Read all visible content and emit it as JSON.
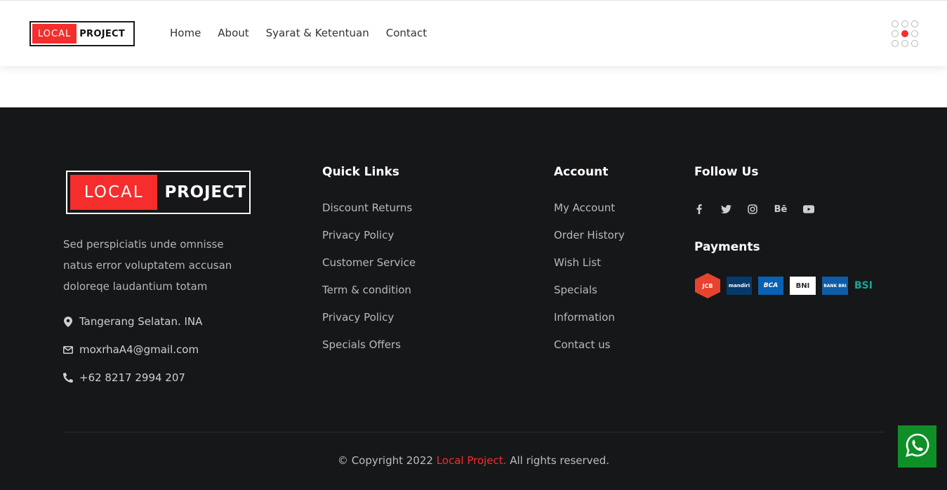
{
  "header": {
    "logo": {
      "left": "LOCAL",
      "right": "PROJECT"
    },
    "nav": [
      "Home",
      "About",
      "Syarat & Ketentuan",
      "Contact"
    ],
    "menu_icon": "dots-grid-icon"
  },
  "footer": {
    "logo": {
      "left": "LOCAL",
      "right": "PROJECT"
    },
    "about": "Sed perspiciatis unde omnisse natus error voluptatem accusan doloreqe laudantium totam",
    "contacts": {
      "address": "Tangerang Selatan. INA",
      "email": "moxrhaA4@gmail.com",
      "phone": "+62 8217 2994 207"
    },
    "quick_links": {
      "title": "Quick Links",
      "items": [
        "Discount Returns",
        "Privacy Policy",
        "Customer Service",
        "Term & condition",
        "Privacy Policy",
        "Specials Offers"
      ]
    },
    "account": {
      "title": "Account",
      "items": [
        "My Account",
        "Order History",
        "Wish List",
        "Specials",
        "Information",
        "Contact us"
      ]
    },
    "follow": {
      "title": "Follow Us",
      "icons": [
        "facebook-icon",
        "twitter-icon",
        "instagram-icon",
        "behance-icon",
        "youtube-icon"
      ]
    },
    "payments": {
      "title": "Payments",
      "logos": [
        "JCB",
        "mandiri",
        "BCA",
        "BNI",
        "BANK BRI",
        "BSI"
      ]
    },
    "copyright": {
      "prefix": "© Copyright 2022 ",
      "brand": "Local Project.",
      "suffix": " All rights reserved."
    }
  },
  "colors": {
    "accent": "#f62d2d",
    "footer_bg": "#161718",
    "whatsapp": "#0f8f27"
  }
}
